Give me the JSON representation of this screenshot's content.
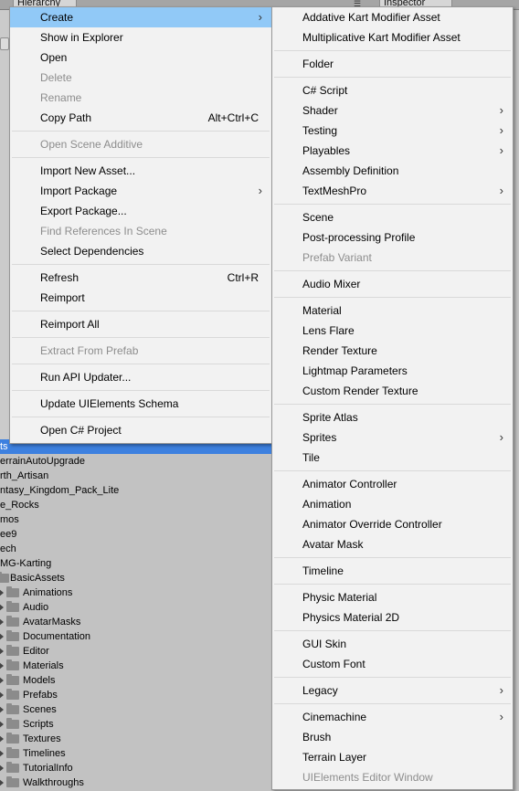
{
  "editor": {
    "hierarchy_tab": "Hierarchy",
    "inspector_tab": "Inspector",
    "project_rows": [
      {
        "label": "ts",
        "selected": true
      },
      {
        "label": "errainAutoUpgrade"
      },
      {
        "label": "rth_Artisan"
      },
      {
        "label": "ntasy_Kingdom_Pack_Lite"
      },
      {
        "label": "e_Rocks"
      },
      {
        "label": "mos"
      },
      {
        "label": "ee9"
      },
      {
        "label": "ech"
      },
      {
        "label": "MG-Karting"
      },
      {
        "label": "BasicAssets"
      },
      {
        "label": "Animations"
      },
      {
        "label": "Audio"
      },
      {
        "label": "AvatarMasks"
      },
      {
        "label": "Documentation"
      },
      {
        "label": "Editor"
      },
      {
        "label": "Materials"
      },
      {
        "label": "Models"
      },
      {
        "label": "Prefabs"
      },
      {
        "label": "Scenes"
      },
      {
        "label": "Scripts"
      },
      {
        "label": "Textures"
      },
      {
        "label": "Timelines"
      },
      {
        "label": "TutorialInfo"
      },
      {
        "label": "Walkthroughs"
      }
    ]
  },
  "context_menu": [
    {
      "label": "Create",
      "submenu": true,
      "highlighted": true
    },
    {
      "label": "Show in Explorer"
    },
    {
      "label": "Open"
    },
    {
      "label": "Delete",
      "disabled": true
    },
    {
      "label": "Rename",
      "disabled": true
    },
    {
      "label": "Copy Path",
      "shortcut": "Alt+Ctrl+C"
    },
    {
      "separator": true
    },
    {
      "label": "Open Scene Additive",
      "disabled": true
    },
    {
      "separator": true
    },
    {
      "label": "Import New Asset..."
    },
    {
      "label": "Import Package",
      "submenu": true
    },
    {
      "label": "Export Package..."
    },
    {
      "label": "Find References In Scene",
      "disabled": true
    },
    {
      "label": "Select Dependencies"
    },
    {
      "separator": true
    },
    {
      "label": "Refresh",
      "shortcut": "Ctrl+R"
    },
    {
      "label": "Reimport"
    },
    {
      "separator": true
    },
    {
      "label": "Reimport All"
    },
    {
      "separator": true
    },
    {
      "label": "Extract From Prefab",
      "disabled": true
    },
    {
      "separator": true
    },
    {
      "label": "Run API Updater..."
    },
    {
      "separator": true
    },
    {
      "label": "Update UIElements Schema"
    },
    {
      "separator": true
    },
    {
      "label": "Open C# Project"
    }
  ],
  "create_submenu": [
    {
      "label": "Addative Kart Modifier Asset"
    },
    {
      "label": "Multiplicative Kart Modifier Asset"
    },
    {
      "separator": true
    },
    {
      "label": "Folder"
    },
    {
      "separator": true
    },
    {
      "label": "C# Script"
    },
    {
      "label": "Shader",
      "submenu": true
    },
    {
      "label": "Testing",
      "submenu": true
    },
    {
      "label": "Playables",
      "submenu": true
    },
    {
      "label": "Assembly Definition"
    },
    {
      "label": "TextMeshPro",
      "submenu": true
    },
    {
      "separator": true
    },
    {
      "label": "Scene"
    },
    {
      "label": "Post-processing Profile"
    },
    {
      "label": "Prefab Variant",
      "disabled": true
    },
    {
      "separator": true
    },
    {
      "label": "Audio Mixer"
    },
    {
      "separator": true
    },
    {
      "label": "Material"
    },
    {
      "label": "Lens Flare"
    },
    {
      "label": "Render Texture"
    },
    {
      "label": "Lightmap Parameters"
    },
    {
      "label": "Custom Render Texture"
    },
    {
      "separator": true
    },
    {
      "label": "Sprite Atlas"
    },
    {
      "label": "Sprites",
      "submenu": true
    },
    {
      "label": "Tile"
    },
    {
      "separator": true
    },
    {
      "label": "Animator Controller"
    },
    {
      "label": "Animation"
    },
    {
      "label": "Animator Override Controller"
    },
    {
      "label": "Avatar Mask"
    },
    {
      "separator": true
    },
    {
      "label": "Timeline"
    },
    {
      "separator": true
    },
    {
      "label": "Physic Material"
    },
    {
      "label": "Physics Material 2D"
    },
    {
      "separator": true
    },
    {
      "label": "GUI Skin"
    },
    {
      "label": "Custom Font"
    },
    {
      "separator": true
    },
    {
      "label": "Legacy",
      "submenu": true
    },
    {
      "separator": true
    },
    {
      "label": "Cinemachine",
      "submenu": true
    },
    {
      "label": "Brush"
    },
    {
      "label": "Terrain Layer"
    },
    {
      "label": "UIElements Editor Window",
      "disabled": true
    }
  ],
  "icons": {
    "submenu_arrow": "chevron-right-icon",
    "folder": "folder-icon",
    "tree_expand": "triangle-right-icon"
  },
  "colors": {
    "menu_bg": "#f2f2f2",
    "highlight": "#91c9f7",
    "disabled_text": "#8d8d8d",
    "selection": "#3d80df",
    "panel_bg": "#c2c2c2"
  }
}
